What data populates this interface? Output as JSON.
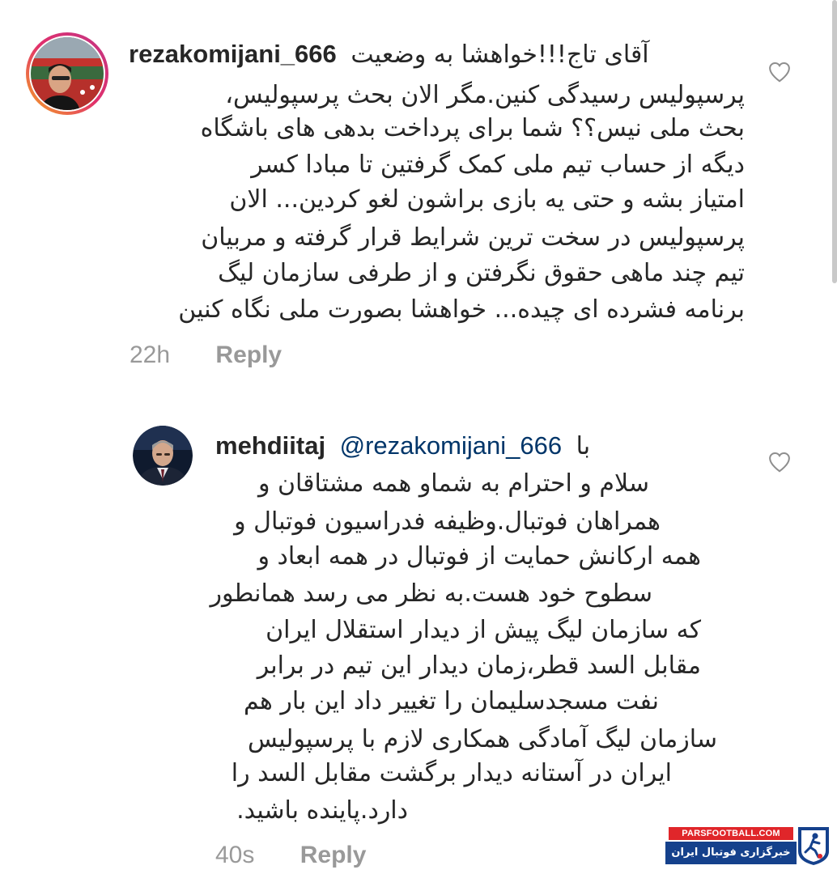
{
  "comments": [
    {
      "username": "rezakomijani_666",
      "first_line_text": "آقای تاج!!!خواهشا به وضعیت",
      "lines": [
        "پرسپولیس رسیدگی کنین.مگر الان بحث پرسپولیس،",
        "بحث ملی نیس؟؟ شما برای پرداخت بدهی های باشگاه",
        "دیگه از حساب تیم ملی کمک گرفتین تا مبادا کسر",
        "امتیاز بشه و حتی یه بازی براشون لغو کردین... الان",
        "پرسپولیس در سخت ترین شرایط قرار گرفته و مربیان",
        "تیم چند ماهی حقوق نگرفتن و از طرفی سازمان لیگ",
        "برنامه فشرده ای چیده... خواهشا بصورت ملی نگاه کنین"
      ],
      "time": "22h",
      "reply_label": "Reply"
    },
    {
      "username": "mehdiitaj",
      "mention": "@rezakomijani_666",
      "mention_suffix": "با",
      "lines": [
        "سلام و احترام به شماو  همه مشتاقان و",
        "همراهان فوتبال.وظیفه فدراسیون فوتبال و",
        "همه ارکانش حمایت از فوتبال در همه ابعاد و",
        "سطوح خود هست.به نظر می رسد همانطور",
        "که سازمان لیگ پیش از دیدار استقلال ایران",
        "مقابل السد قطر،زمان دیدار این تیم در برابر",
        "نفت مسجدسلیمان را تغییر داد این بار هم",
        "سازمان لیگ آمادگی همکاری لازم با پرسپولیس",
        "ایران در آستانه دیدار برگشت مقابل السد را",
        "دارد.پاینده باشید."
      ],
      "time": "40s",
      "reply_label": "Reply"
    }
  ],
  "watermark": {
    "top_text": "PARSFOOTBALL.COM",
    "bottom_text": "خبرگزاری فوتبال ایران"
  },
  "colors": {
    "text": "#262626",
    "meta": "#999999",
    "mention": "#003569",
    "watermark_red": "#e0262a",
    "watermark_blue": "#15418c"
  },
  "icons": {
    "like": "heart-outline-icon"
  }
}
